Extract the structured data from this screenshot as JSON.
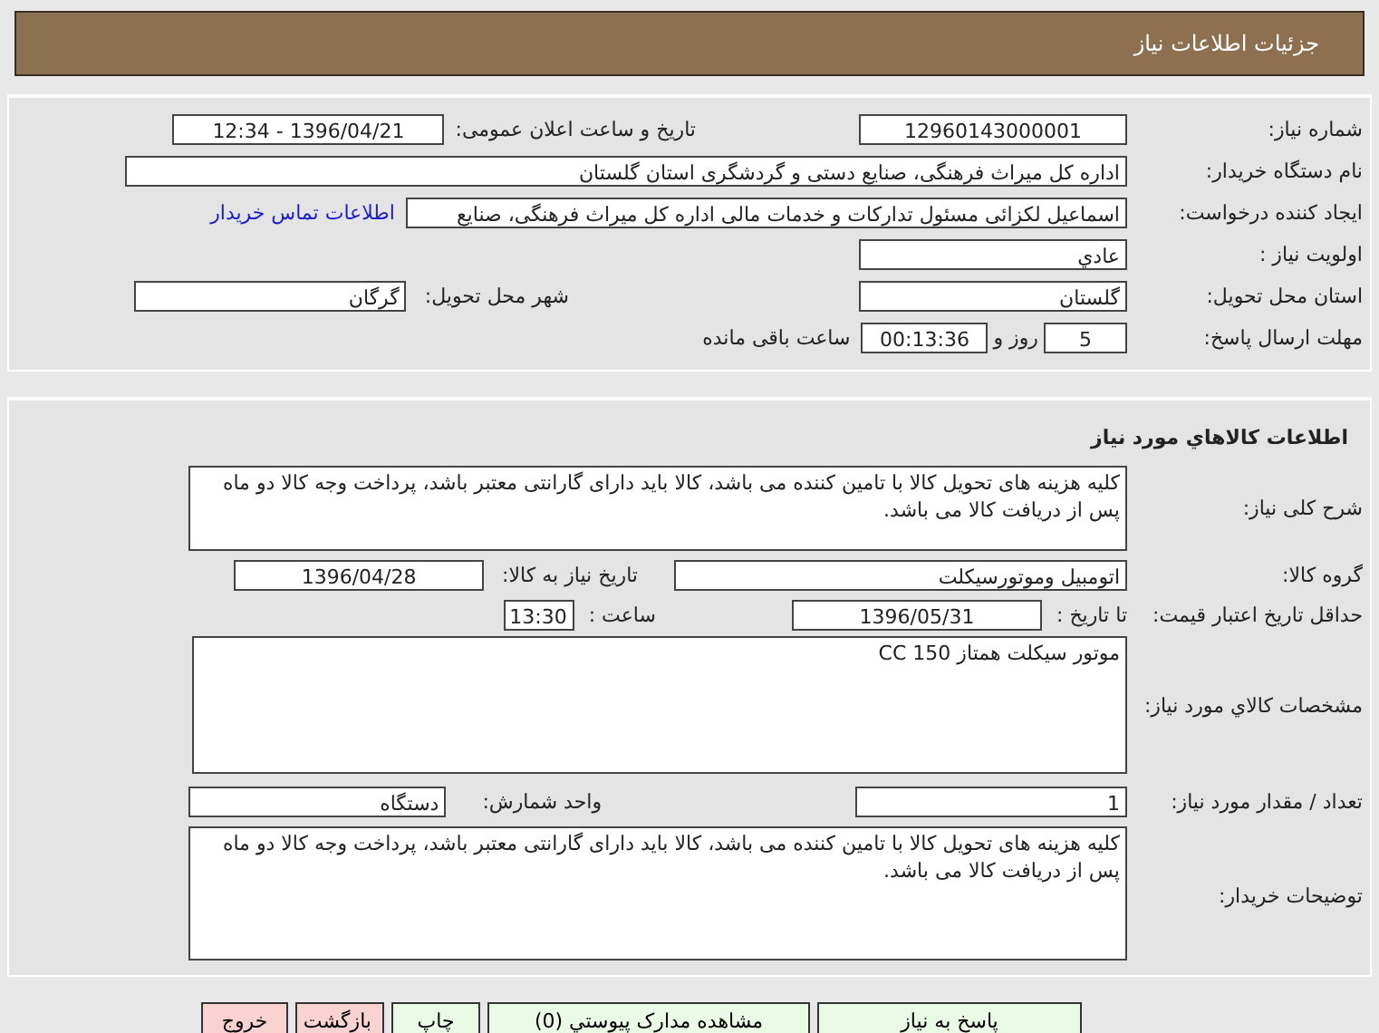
{
  "header": {
    "title": "جزئیات اطلاعات نیاز"
  },
  "need_info": {
    "need_number": {
      "label": "شماره نیاز:",
      "value": "12960143000001"
    },
    "announce_datetime": {
      "label": "تاریخ و ساعت اعلان عمومی:",
      "value": "1396/04/21 - 12:34"
    },
    "buyer_org": {
      "label": "نام دستگاه خریدار:",
      "value": "اداره کل میراث فرهنگی، صنایع دستی و گردشگری استان گلستان"
    },
    "requester": {
      "label": "ایجاد کننده درخواست:",
      "value": "اسماعیل لکزائی مسئول تدارکات و خدمات مالی اداره کل میراث فرهنگی، صنایع"
    },
    "contact_link": "اطلاعات تماس خریدار",
    "priority": {
      "label": "اولویت نیاز :",
      "value": "عادي"
    },
    "province": {
      "label": "استان محل تحویل:",
      "value": "گلستان"
    },
    "city": {
      "label": "شهر محل تحویل:",
      "value": "گرگان"
    },
    "deadline": {
      "label": "مهلت ارسال پاسخ:",
      "days": "5",
      "days_unit": "روز و",
      "time": "00:13:36",
      "remaining": "ساعت باقی مانده"
    }
  },
  "goods": {
    "title": "اطلاعات کالاهاي مورد نياز",
    "description": {
      "label": "شرح کلی نیاز:",
      "value": "کلیه هزینه های تحویل کالا با تامین کننده می باشد، کالا باید دارای گارانتی معتبر باشد، پرداخت وجه کالا دو ماه پس از دریافت کالا می باشد."
    },
    "group": {
      "label": "گروه کالا:",
      "value": "اتومبیل وموتورسیکلت"
    },
    "need_date": {
      "label": "تاریخ نیاز به کالا:",
      "value": "1396/04/28"
    },
    "price_validity": {
      "label": "حداقل تاریخ اعتبار قیمت:",
      "until_label": "تا تاریخ :",
      "date": "1396/05/31",
      "time_label": "ساعت :",
      "time": "13:30"
    },
    "specs": {
      "label": "مشخصات کالاي مورد نياز:",
      "value": "موتور سیکلت همتاز 150 CC"
    },
    "quantity": {
      "label": "تعداد / مقدار مورد نیاز:",
      "value": "1"
    },
    "unit": {
      "label": "واحد شمارش:",
      "value": "دستگاه"
    },
    "buyer_notes": {
      "label": "توضیحات خریدار:",
      "value": "کلیه هزینه های تحویل کالا با تامین کننده می باشد، کالا باید دارای گارانتی معتبر باشد، پرداخت وجه کالا دو ماه پس از دریافت کالا می باشد."
    }
  },
  "buttons": [
    {
      "label": "پاسخ به نیاز",
      "kind": "action"
    },
    {
      "label": "مشاهده مدارک پیوستي (0)",
      "kind": "action"
    },
    {
      "label": "چاپ",
      "kind": "action"
    },
    {
      "label": "بازگشت",
      "kind": "danger"
    },
    {
      "label": "خروج",
      "kind": "danger"
    }
  ]
}
